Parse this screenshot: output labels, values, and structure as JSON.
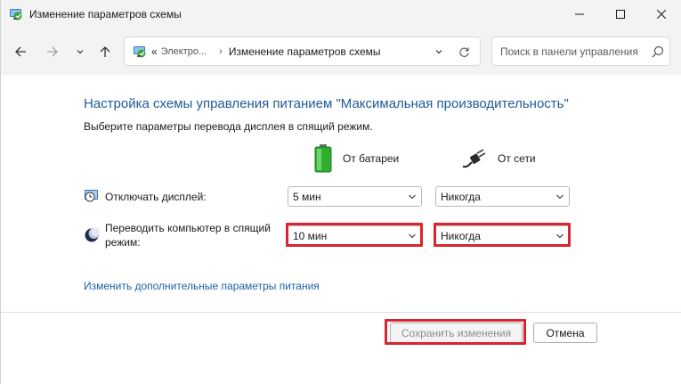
{
  "window": {
    "title": "Изменение параметров схемы"
  },
  "nav": {
    "breadcrumbs": [
      "«",
      "Электро...",
      "Изменение параметров схемы"
    ],
    "search_placeholder": "Поиск в панели управления"
  },
  "main": {
    "heading": "Настройка схемы управления питанием \"Максимальная производительность\"",
    "subtext": "Выберите параметры перевода дисплея в спящий режим.",
    "columns": {
      "battery": "От батареи",
      "plugged_in": "От сети"
    },
    "settings": [
      {
        "label": "Отключать дисплей:",
        "icon": "display-timer-icon",
        "battery_value": "5 мин",
        "plugged_value": "Никогда"
      },
      {
        "label_line1": "Переводить компьютер в спящий",
        "label_line2": "режим:",
        "icon": "sleep-moon-icon",
        "battery_value": "10 мин",
        "plugged_value": "Никогда"
      }
    ],
    "advanced_link": "Изменить дополнительные параметры питания"
  },
  "footer": {
    "save_label": "Сохранить изменения",
    "cancel_label": "Отмена"
  },
  "colors": {
    "heading": "#1e5a96",
    "link": "#1e62a8",
    "highlight": "#d9262e",
    "battery_green": "#2fae2f"
  }
}
